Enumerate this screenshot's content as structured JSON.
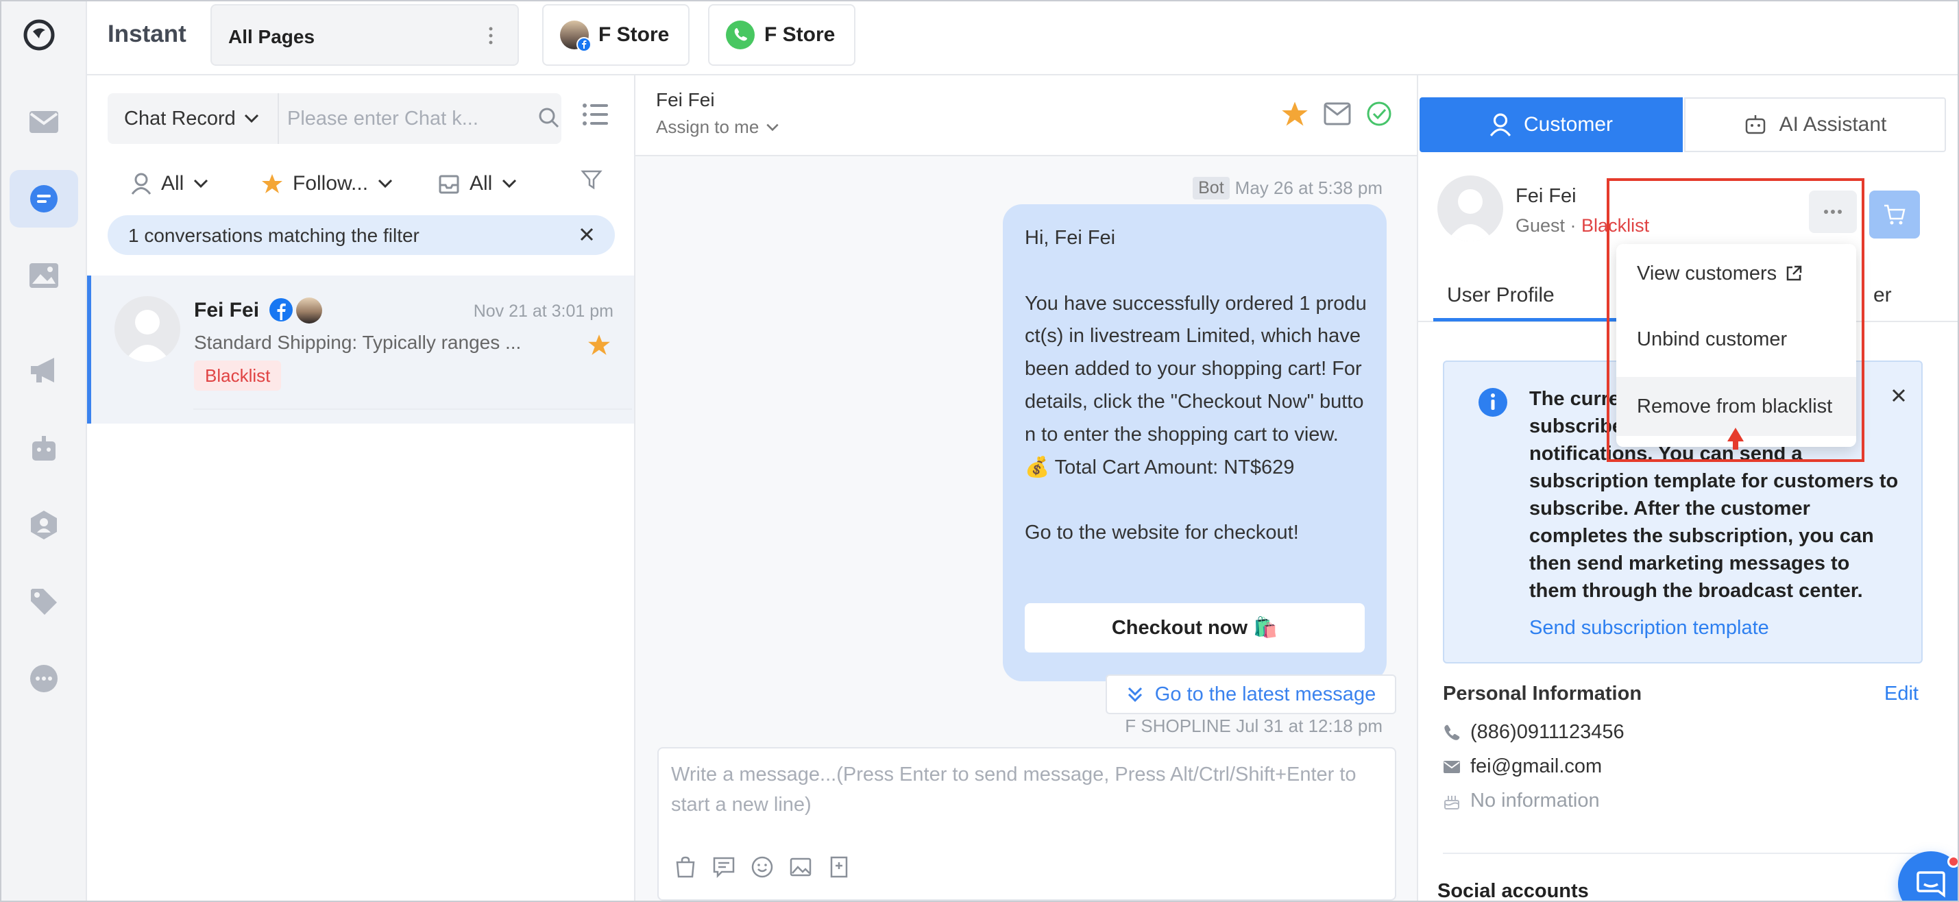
{
  "app": {
    "title": "Instant"
  },
  "topbar": {
    "page_select": "All Pages",
    "stores": [
      {
        "label": "F Store",
        "channel": "facebook"
      },
      {
        "label": "F Store",
        "channel": "whatsapp"
      }
    ]
  },
  "rail": {
    "items": [
      "mail-icon",
      "chat-icon",
      "image-icon",
      "megaphone-icon",
      "robot-icon",
      "contacts-icon",
      "tag-icon",
      "more-icon"
    ],
    "active": "chat-icon"
  },
  "conversations": {
    "search_scope": "Chat Record",
    "search_placeholder": "Please enter Chat k...",
    "filters": {
      "assignee": "All",
      "follow": "Follow...",
      "inbox": "All"
    },
    "match_banner": "1 conversations matching the filter",
    "items": [
      {
        "name": "Fei Fei",
        "time": "Nov 21 at 3:01 pm",
        "snippet": "Standard Shipping: Typically ranges ...",
        "tag": "Blacklist",
        "starred": true
      }
    ]
  },
  "chat": {
    "contact_name": "Fei Fei",
    "assign_label": "Assign to me",
    "bot_badge": "Bot",
    "bot_time": "May 26 at 5:38 pm",
    "message": "Hi, Fei Fei\n\nYou have successfully ordered 1 product(s) in livestream Limited, which have been added to your shopping cart! For details, click the \"Checkout Now\" button to enter the shopping cart to view.\n💰 Total Cart Amount: NT$629\n\nGo to the website for checkout!",
    "checkout_button": "Checkout now 🛍️",
    "latest_button": "Go to the latest message",
    "sender_meta": "F SHOPLINE Jul 31 at 12:18 pm",
    "composer_placeholder": "Write a message...(Press Enter to send message, Press Alt/Ctrl/Shift+Enter to start a new line)"
  },
  "right_panel": {
    "tabs": {
      "customer": "Customer",
      "ai": "AI Assistant"
    },
    "customer": {
      "name": "Fei Fei",
      "type": "Guest",
      "separator": " · ",
      "status": "Blacklist"
    },
    "sub_tabs": {
      "profile": "User Profile",
      "other_fragment": "er"
    },
    "info": {
      "text_fragments": {
        "line1": "The curre",
        "line2": "subscribe",
        "line3": "notifications. You can send a"
      },
      "text_rest": "subscription template for customers to subscribe. After the customer completes the subscription, you can then send marketing messages to them through the broadcast center.",
      "link": "Send subscription template"
    },
    "personal": {
      "title": "Personal Information",
      "edit": "Edit",
      "phone": "(886)0911123456",
      "email": "fei@gmail.com",
      "birthday": "No information"
    },
    "social_title": "Social accounts"
  },
  "dropdown": {
    "items": [
      "View customers",
      "Unbind customer",
      "Remove from blacklist"
    ],
    "hovered_index": 2
  },
  "colors": {
    "accent": "#2d7ff0",
    "danger": "#e04343",
    "highlight": "#e53b2c",
    "star": "#f4a636"
  }
}
